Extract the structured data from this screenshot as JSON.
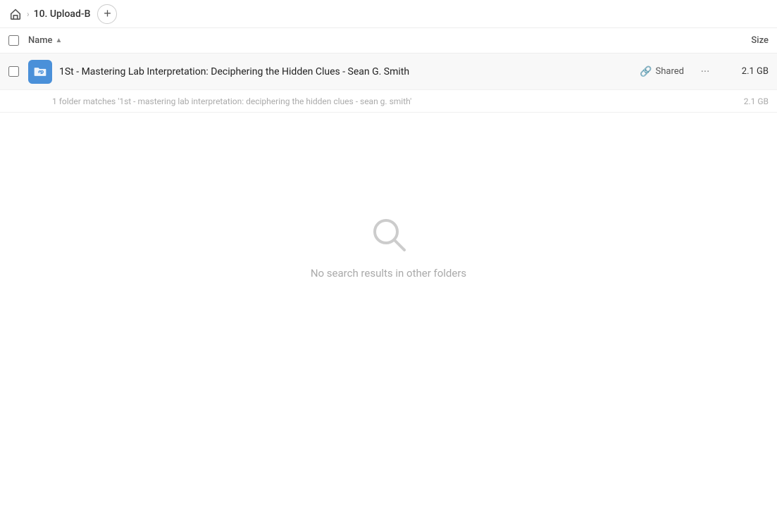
{
  "breadcrumb": {
    "home_label": "Home",
    "separator": "›",
    "current": "10. Upload-B"
  },
  "add_button_label": "+",
  "columns": {
    "name_label": "Name",
    "sort_indicator": "▲",
    "size_label": "Size"
  },
  "file_row": {
    "icon_alt": "folder-link-icon",
    "name": "1St - Mastering Lab Interpretation: Deciphering the Hidden Clues - Sean G. Smith",
    "shared_label": "Shared",
    "more_label": "···",
    "size": "2.1 GB"
  },
  "match_note": {
    "text": "1 folder matches '1st - mastering lab interpretation: deciphering the hidden clues - sean g. smith'",
    "size": "2.1 GB"
  },
  "empty_state": {
    "message": "No search results in other folders"
  }
}
